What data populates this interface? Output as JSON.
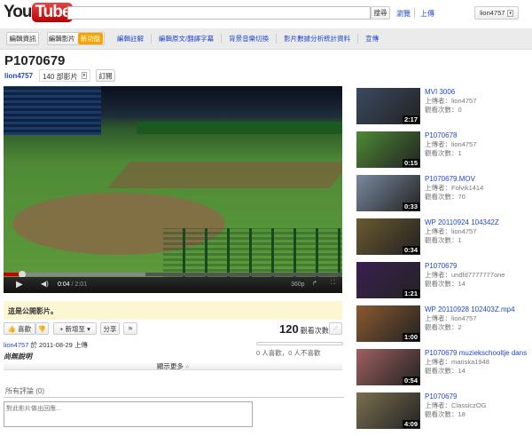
{
  "header": {
    "logo": "YouTube",
    "search_button": "搜尋",
    "browse": "瀏覽",
    "upload": "上傳",
    "user": "lion4757"
  },
  "toolbar": {
    "edit_info": "編輯資訊",
    "edit_video": "編輯影片",
    "new_badge": "新功能",
    "links": [
      "編輯註解",
      "編輯原文/翻譯字幕",
      "背景音樂切換",
      "影片數據分析統計資料",
      "宣傳"
    ]
  },
  "video": {
    "title": "P1070679",
    "channel": "lion4757",
    "video_count": "140 部影片",
    "subscribe": "訂閱",
    "time_current": "0:04",
    "time_total": "/ 2:01",
    "quality": "360p",
    "progress": 0.033
  },
  "notice": "這是公開影片。",
  "actions": {
    "like": "喜歡",
    "add_to": "新增至",
    "share": "分享",
    "views": "120",
    "views_label": "觀看次數",
    "likes_summary": "0 人喜歡，0 人不喜歡"
  },
  "upload_info": {
    "user": "lion4757",
    "text": "於 2011-08-29 上傳",
    "description": "尚無說明",
    "show_more": "顯示更多"
  },
  "comments": {
    "header": "所有評論",
    "count": "(0)",
    "placeholder": "對此影片做出回應..."
  },
  "related": [
    {
      "title": "MVI 3006",
      "uploader": "上傳者：lion4757",
      "views": "觀看次數：0",
      "duration": "2:17",
      "color": "#3a4a60"
    },
    {
      "title": "P1070678",
      "uploader": "上傳者：lion4757",
      "views": "觀看次數：1",
      "duration": "0:15",
      "color": "#4e8a35"
    },
    {
      "title": "P1070679.MOV",
      "uploader": "上傳者：Folvik1414",
      "views": "觀看次數：70",
      "duration": "0:33",
      "color": "#7a8aa0"
    },
    {
      "title": "WP 20110924 104342Z",
      "uploader": "上傳者：lion4757",
      "views": "觀看次數：1",
      "duration": "0:34",
      "color": "#6a5a30"
    },
    {
      "title": "P1070679",
      "uploader": "上傳者：undfd7777777one",
      "views": "觀看次數：14",
      "duration": "1:21",
      "color": "#3a2050"
    },
    {
      "title": "WP 20110928 102403Z.mp4",
      "uploader": "上傳者：lion4757",
      "views": "觀看次數：2",
      "duration": "1:00",
      "color": "#8a5a30"
    },
    {
      "title": "P1070679 muziekschooltje dans",
      "uploader": "上傳者：mariska1948",
      "views": "觀看次數：14",
      "duration": "0:54",
      "color": "#a06060"
    },
    {
      "title": "P1070679",
      "uploader": "上傳者：ClassiczOG",
      "views": "觀看次數：18",
      "duration": "4:09",
      "color": "#7a7050"
    }
  ]
}
